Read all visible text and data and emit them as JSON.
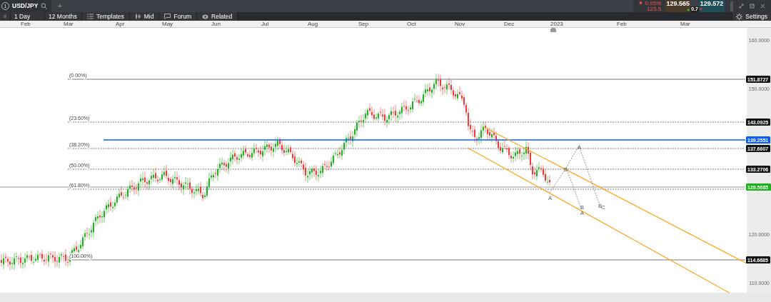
{
  "top_bar": {
    "tab_number": "1",
    "symbol": "USD/JPY",
    "add_tab": "+",
    "change": "▼ 0.95%",
    "change_points": "125.5",
    "sell_price": "129.565",
    "buy_price": "129.572",
    "spread": "0.7",
    "spread_up": "▲",
    "spread_down": "▼"
  },
  "toolbar": {
    "items": [
      {
        "label": "1 Day",
        "kind": "dropdown"
      },
      {
        "label": "12 Months",
        "kind": "dropdown"
      },
      {
        "label": "Templates",
        "kind": "templates"
      },
      {
        "label": "Mid",
        "kind": "mid"
      },
      {
        "label": "Forum",
        "kind": "forum"
      },
      {
        "label": "Related",
        "kind": "related"
      }
    ],
    "settings": "Settings"
  },
  "chart": {
    "months": [
      "Feb",
      "Mar",
      "Apr",
      "May",
      "Jun",
      "Jul",
      "Aug",
      "Sep",
      "Oct",
      "Nov",
      "Dec",
      "2023",
      "Feb",
      "Mar"
    ],
    "price_ticks": [
      "160.0000",
      "150.0000",
      "120.0000",
      "110.0000"
    ],
    "fib_levels": [
      {
        "label": "(0.00%)",
        "tag": "151.8727"
      },
      {
        "label": "(23.60%)",
        "tag": "143.0925"
      },
      {
        "label": "(38.20%)",
        "tag": "137.6607"
      },
      {
        "label": "(50.00%)",
        "tag": "133.2706"
      },
      {
        "label": "(61.80%)"
      },
      {
        "label": "(100.00%)",
        "tag": "114.6685"
      }
    ],
    "horizontal_line": {
      "tag": "139.2551"
    },
    "current_price": {
      "tag": "129.5685"
    },
    "wave_labels": [
      "A",
      "B",
      "A",
      "B",
      "A",
      "B",
      "C"
    ]
  }
}
